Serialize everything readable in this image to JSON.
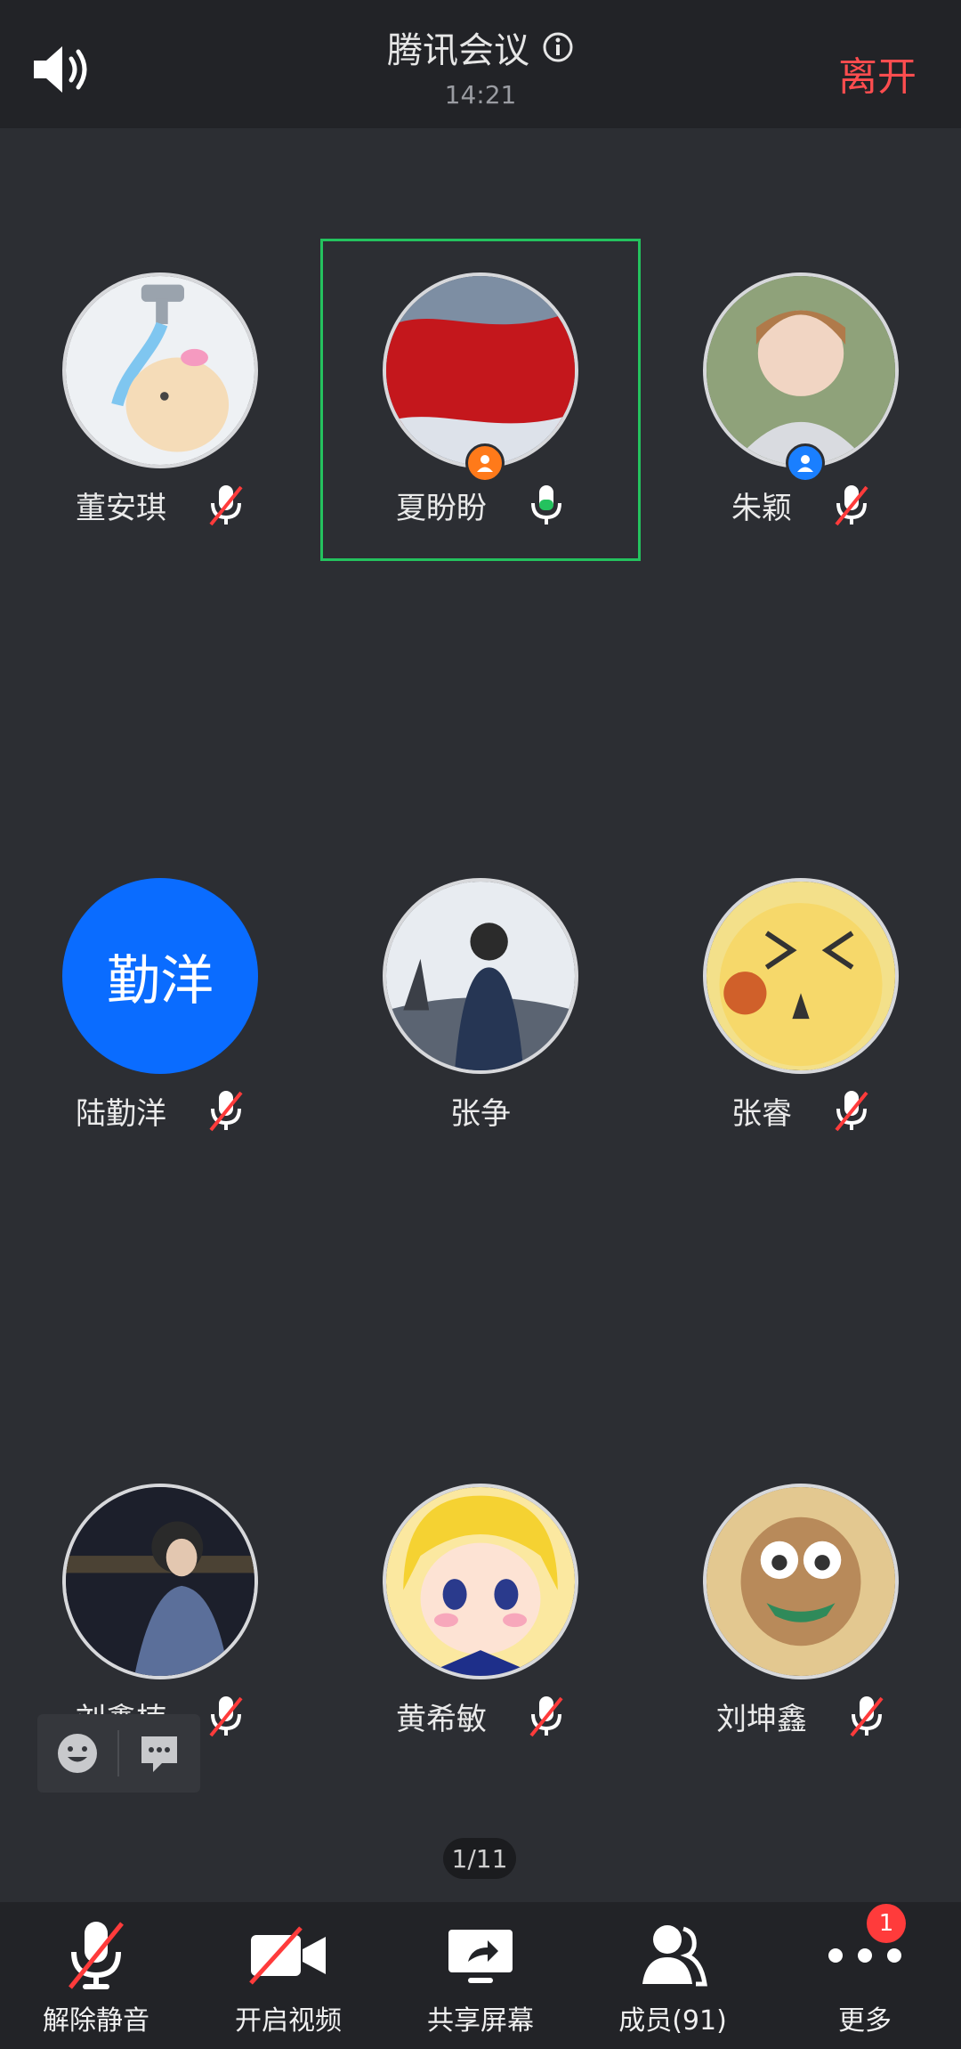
{
  "header": {
    "title": "腾讯会议",
    "time": "14:21",
    "leave_label": "离开"
  },
  "participants": [
    {
      "name": "董安琪",
      "mic": "muted"
    },
    {
      "name": "夏盼盼",
      "mic": "active",
      "role": "host"
    },
    {
      "name": "朱颖",
      "mic": "muted",
      "role": "cohost"
    },
    {
      "name": "陆勤洋",
      "mic": "muted",
      "avatar_text": "勤洋"
    },
    {
      "name": "张争",
      "mic": "none"
    },
    {
      "name": "张睿",
      "mic": "muted"
    },
    {
      "name": "刘鑫楠",
      "mic": "muted"
    },
    {
      "name": "黄希敏",
      "mic": "muted"
    },
    {
      "name": "刘坤鑫",
      "mic": "muted"
    }
  ],
  "pager": "1/11",
  "toolbar": {
    "unmute_label": "解除静音",
    "video_label": "开启视频",
    "share_label": "共享屏幕",
    "members_label": "成员(91)",
    "more_label": "更多",
    "more_badge": "1"
  },
  "colors": {
    "accent_red": "#ff4d4f",
    "active_green": "#24c25e",
    "avatar_blue": "#0a6cff",
    "host_orange": "#ff7a1a"
  }
}
